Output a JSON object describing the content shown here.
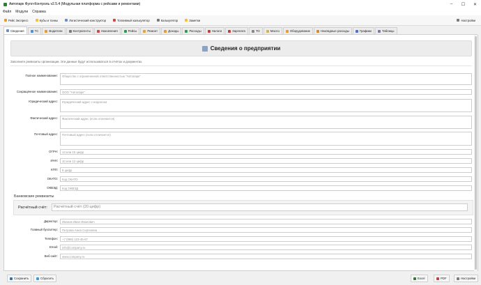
{
  "window": {
    "title": "Автопарк Фулл-Контроль v2.5.4 (Модульная платформа с рейсами и ремонтами)",
    "minimize": "–",
    "maximize": "☐",
    "close": "✕"
  },
  "menu": [
    "Файл",
    "Модули",
    "Справка"
  ],
  "toolbar": {
    "items": [
      {
        "label": "Рейс Экспресс",
        "color": "#e89a2c"
      },
      {
        "label": "Кубы и тонны",
        "color": "#f2c233"
      },
      {
        "label": "Логистический конструктор",
        "color": "#6a8fc7"
      },
      {
        "label": "Топливный калькулятор",
        "color": "#d64545"
      },
      {
        "label": "Калькулятор",
        "color": "#7a7a7a"
      },
      {
        "label": "Заметки",
        "color": "#f2c233"
      }
    ],
    "settings": {
      "label": "Настройки",
      "color": "#7a7a7a"
    }
  },
  "tabs": [
    {
      "label": "Сведения",
      "color": "#6a8fc7",
      "active": true
    },
    {
      "label": "ТС",
      "color": "#4a90d9"
    },
    {
      "label": "Водители",
      "color": "#e89a2c"
    },
    {
      "label": "Контрагенты",
      "color": "#7a7a7a"
    },
    {
      "label": "Назначения",
      "color": "#d64545"
    },
    {
      "label": "Рейсы",
      "color": "#2e9b4e"
    },
    {
      "label": "Ремонт",
      "color": "#e8a42c"
    },
    {
      "label": "Доходы",
      "color": "#e89a2c"
    },
    {
      "label": "Расходы",
      "color": "#2e9b4e"
    },
    {
      "label": "Налоги",
      "color": "#c43c3c"
    },
    {
      "label": "Зарплата",
      "color": "#c43c3c"
    },
    {
      "label": "ТО",
      "color": "#888888"
    },
    {
      "label": "Масло",
      "color": "#d6b24a"
    },
    {
      "label": "Оборудование",
      "color": "#e89a2c"
    },
    {
      "label": "Накладные расходы",
      "color": "#d68a2c"
    },
    {
      "label": "Графики",
      "color": "#4a6fd9"
    },
    {
      "label": "Таблицы",
      "color": "#7a7a9a"
    }
  ],
  "page": {
    "title": "Сведения о предприятии",
    "hint": "Заполните реквизиты организации. Эти данные будут использоваться в отчётах и документах."
  },
  "fields": [
    {
      "label": "Полное наименование:",
      "placeholder": "Общество с ограниченной ответственностью \"Автопарк\""
    },
    {
      "label": "Сокращённое наименование:",
      "placeholder": "ООО \"Автопарк\""
    },
    {
      "label": "Юридический адрес:",
      "placeholder": "Юридический адрес с индексом"
    },
    {
      "label": "Фактический адрес:",
      "placeholder": "Фактический адрес (если отличается)"
    },
    {
      "label": "Почтовый адрес:",
      "placeholder": "Почтовый адрес (если отличается)"
    },
    {
      "label": "ОГРН:",
      "placeholder": "13 или 15 цифр"
    },
    {
      "label": "ИНН:",
      "placeholder": "10 или 12 цифр"
    },
    {
      "label": "КПП:",
      "placeholder": "9 цифр"
    },
    {
      "label": "ОКАТО:",
      "placeholder": "Код ОКАТО"
    },
    {
      "label": "ОКВЭД:",
      "placeholder": "Код ОКВЭД"
    }
  ],
  "bank": {
    "title": "Банковские реквизиты",
    "label": "Расчётный счёт:",
    "placeholder": "Расчётный счёт (20 цифр)"
  },
  "contacts": [
    {
      "label": "Директор:",
      "placeholder": "Иванов Иван Иванович"
    },
    {
      "label": "Главный бухгалтер:",
      "placeholder": "Петрова Анна Сергеевна"
    },
    {
      "label": "Телефон:",
      "placeholder": "+7 (999) 123-45-67"
    },
    {
      "label": "Email:",
      "placeholder": "info@company.ru"
    },
    {
      "label": "Веб-сайт:",
      "placeholder": "www.company.ru"
    }
  ],
  "bottom": {
    "save": "Сохранить",
    "reset": "Сбросить",
    "excel": "Excel",
    "pdf": "PDF",
    "settings": "Настройки"
  }
}
